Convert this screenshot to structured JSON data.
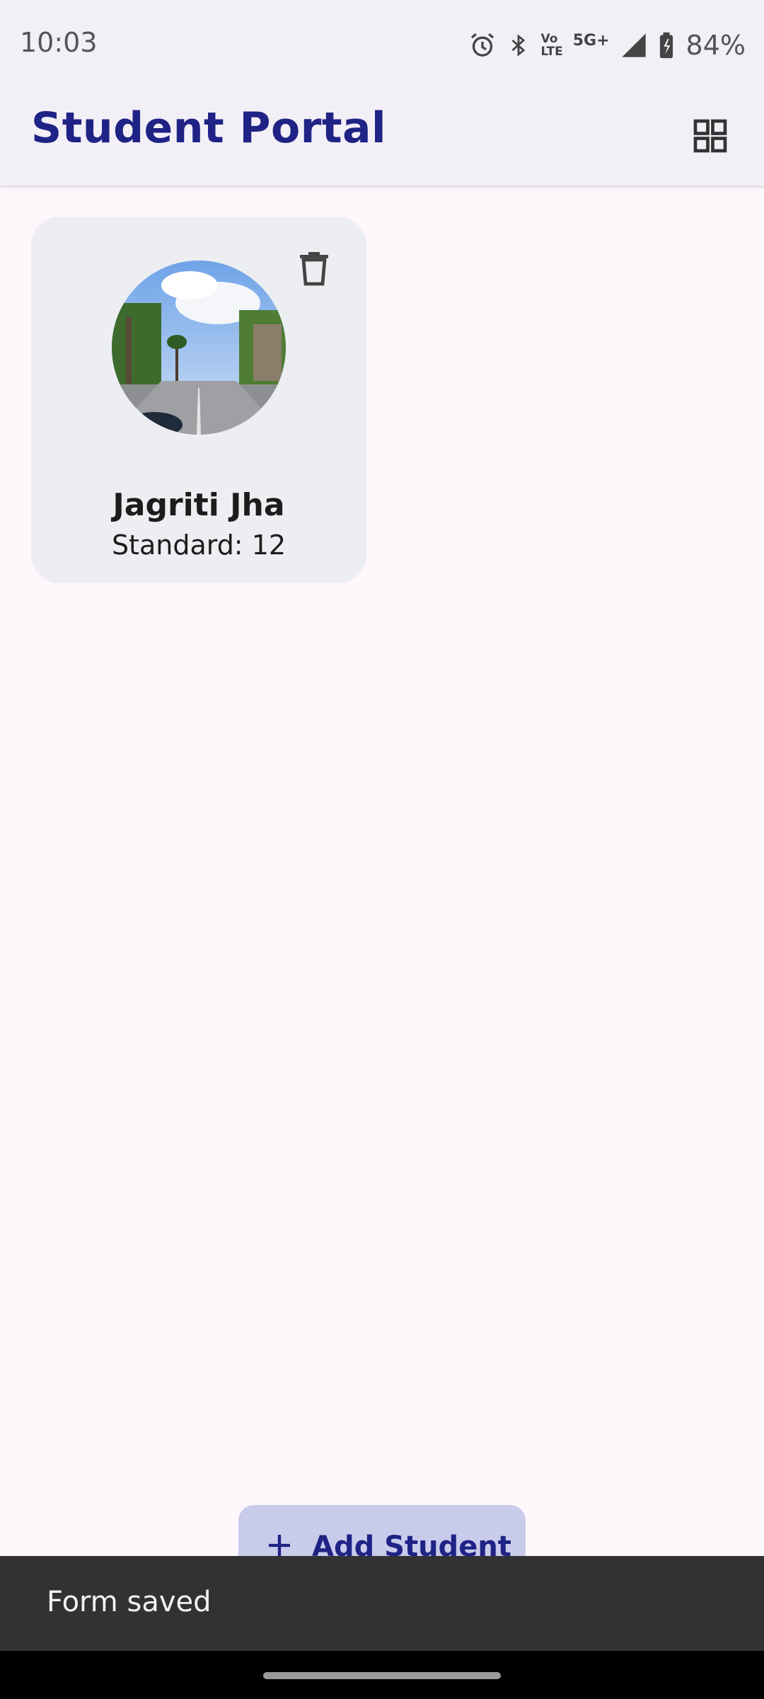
{
  "status_bar": {
    "time": "10:03",
    "network_label_top": "Vo",
    "network_label_bottom": "LTE",
    "network_type": "5G+",
    "battery_percent": "84%"
  },
  "app_bar": {
    "title": "Student Portal",
    "title_color": "#1f2385",
    "view_toggle_icon": "grid-view-icon"
  },
  "students": [
    {
      "name": "Jagriti Jha",
      "standard": "Standard: 12",
      "delete_icon": "trash-icon"
    }
  ],
  "fab": {
    "icon": "plus-icon",
    "label": "Add Student"
  },
  "snackbar": {
    "message": "Form saved"
  }
}
